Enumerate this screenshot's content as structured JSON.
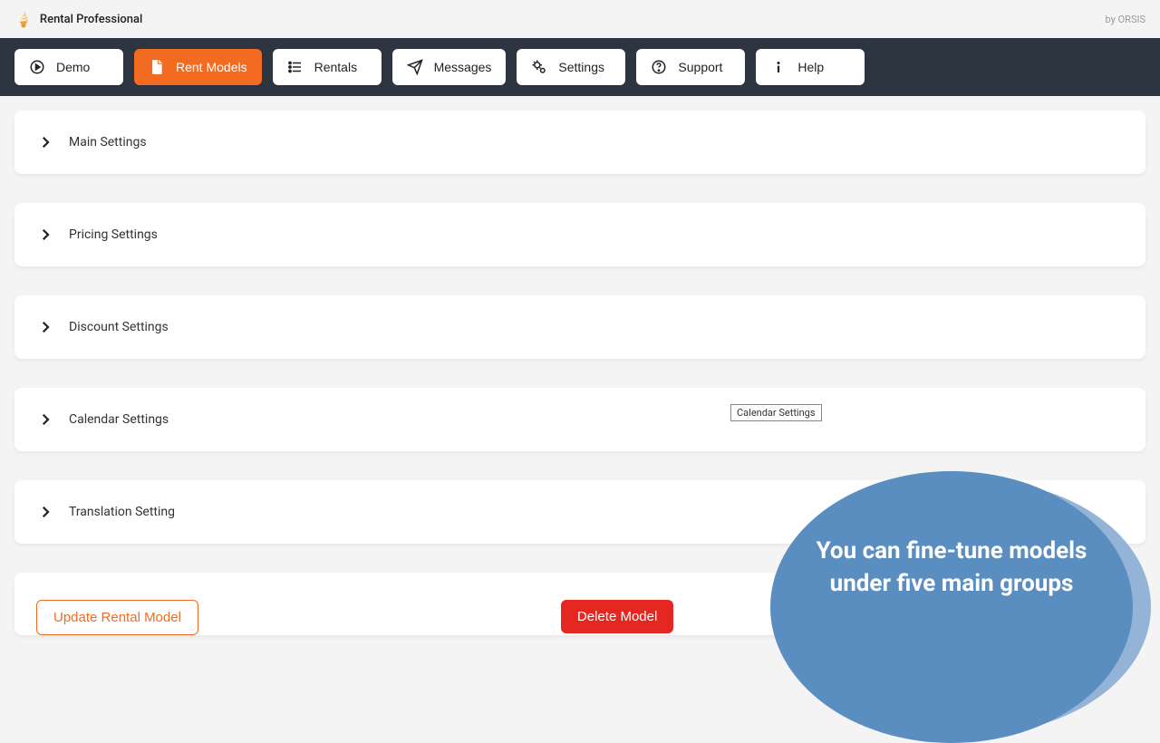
{
  "header": {
    "app_title": "Rental Professional",
    "by_text": "by ORSIS"
  },
  "nav": {
    "items": [
      {
        "label": "Demo",
        "icon": "play",
        "active": false
      },
      {
        "label": "Rent Models",
        "icon": "file",
        "active": true
      },
      {
        "label": "Rentals",
        "icon": "list",
        "active": false
      },
      {
        "label": "Messages",
        "icon": "send",
        "active": false
      },
      {
        "label": "Settings",
        "icon": "gears",
        "active": false
      },
      {
        "label": "Support",
        "icon": "question",
        "active": false
      },
      {
        "label": "Help",
        "icon": "info",
        "active": false
      }
    ]
  },
  "accordion": {
    "items": [
      {
        "label": "Main Settings"
      },
      {
        "label": "Pricing Settings"
      },
      {
        "label": "Discount Settings"
      },
      {
        "label": "Calendar Settings",
        "tooltip": "Calendar Settings"
      },
      {
        "label": "Translation Setting"
      }
    ]
  },
  "actions": {
    "update_label": "Update Rental Model",
    "delete_label": "Delete Model"
  },
  "callout": {
    "text": "You can fine-tune models under five main groups"
  }
}
